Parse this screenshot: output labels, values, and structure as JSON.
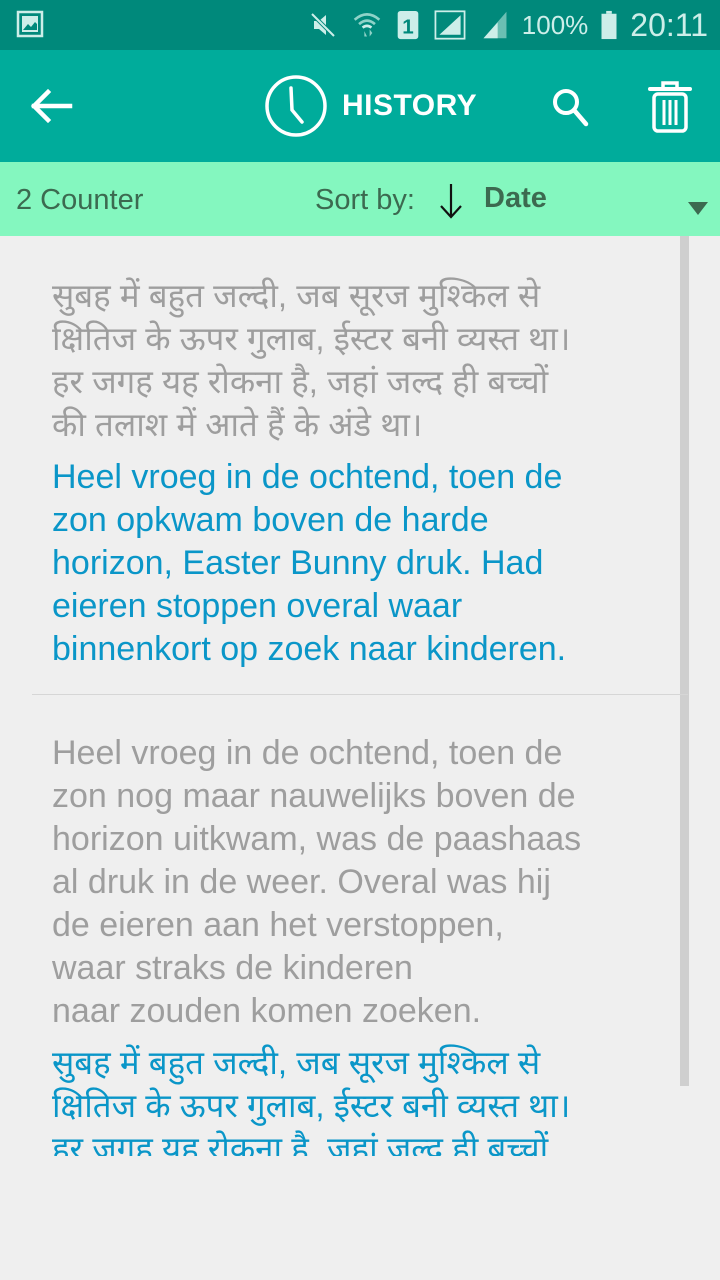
{
  "status_bar": {
    "left_icon": "image-notification-icon",
    "icons": [
      "mute-icon",
      "wifi-data-icon",
      "sim-1-icon",
      "signal-sim1-icon",
      "signal-sim2-icon"
    ],
    "battery_percent": "100%",
    "battery_icon": "battery-full-icon",
    "time": "20:11"
  },
  "app_bar": {
    "back_icon": "arrow-left-icon",
    "title_icon": "clock-icon",
    "title": "HISTORY",
    "search_icon": "search-icon",
    "delete_icon": "trash-icon"
  },
  "sort_bar": {
    "counter": "2 Counter",
    "sort_label": "Sort by:",
    "sort_direction_icon": "arrow-down-icon",
    "sort_value": "Date",
    "dropdown_icon": "caret-down-icon"
  },
  "colors": {
    "status_bar": "#00897b",
    "app_bar": "#00ac9b",
    "sort_bar": "#84f7bf",
    "source_text": "#9e9e9e",
    "translation_text": "#0a96c8",
    "background": "#efefef"
  },
  "history": [
    {
      "source_lines": [
        "सुबह में बहुत जल्दी, जब सूरज मुश्किल से",
        "क्षितिज के ऊपर गुलाब, ईस्टर बनी व्यस्त था।",
        "हर जगह यह रोकना है, जहां जल्द ही बच्चों",
        "की तलाश में आते हैं के अंडे था।"
      ],
      "translation_lines": [
        "Heel vroeg in de ochtend, toen de",
        "zon opkwam boven de harde",
        "horizon, Easter Bunny druk. Had",
        "eieren stoppen overal waar",
        "binnenkort op zoek naar kinderen."
      ]
    },
    {
      "source_lines": [
        "Heel vroeg in de ochtend, toen de",
        "zon nog maar nauwelijks boven de",
        "horizon uitkwam, was de paashaas",
        "al druk in de weer. Overal was hij",
        "de eieren aan het verstoppen,",
        "waar straks de kinderen",
        "naar zouden komen zoeken."
      ],
      "translation_lines": [
        "सुबह में बहुत जल्दी, जब सूरज मुश्किल से",
        "क्षितिज के ऊपर गुलाब, ईस्टर बनी व्यस्त था।",
        "हर जगह यह रोकना है, जहां जल्द ही बच्चों"
      ]
    }
  ]
}
